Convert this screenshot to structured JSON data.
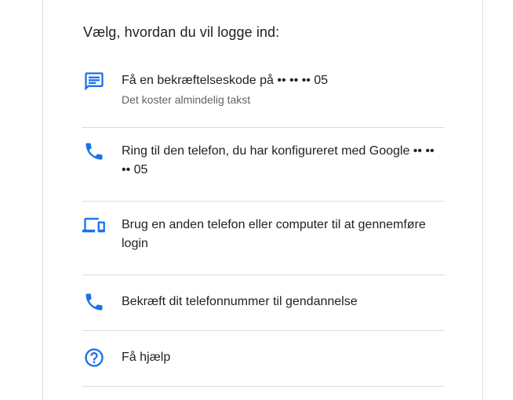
{
  "heading": "Vælg, hvordan du vil logge ind:",
  "accent_color": "#1a73e8",
  "options": [
    {
      "icon": "sms-message-icon",
      "title": "Få en bekræftelseskode på •• •• •• 05",
      "subtitle": "Det koster almindelig takst"
    },
    {
      "icon": "phone-icon",
      "title": "Ring til den telefon, du har konfigureret med Google •• •• •• 05"
    },
    {
      "icon": "devices-icon",
      "title": "Brug en anden telefon eller computer til at gennemføre login"
    },
    {
      "icon": "phone-icon",
      "title": "Bekræft dit telefonnummer til gendannelse"
    },
    {
      "icon": "help-icon",
      "title": "Få hjælp"
    }
  ]
}
